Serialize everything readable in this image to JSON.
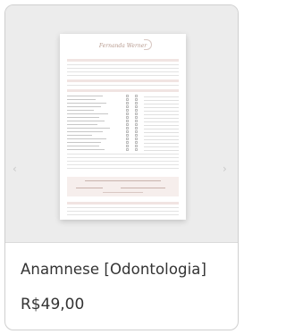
{
  "product": {
    "title": "Anamnese [Odontologia]",
    "price": "R$49,00",
    "image_alt": "Fernanda Werner"
  },
  "colors": {
    "accent": "#f1e4e2",
    "logo": "#b79a8e",
    "text": "#333333"
  },
  "icons": {
    "prev": "chevron-left-icon",
    "next": "chevron-right-icon"
  }
}
